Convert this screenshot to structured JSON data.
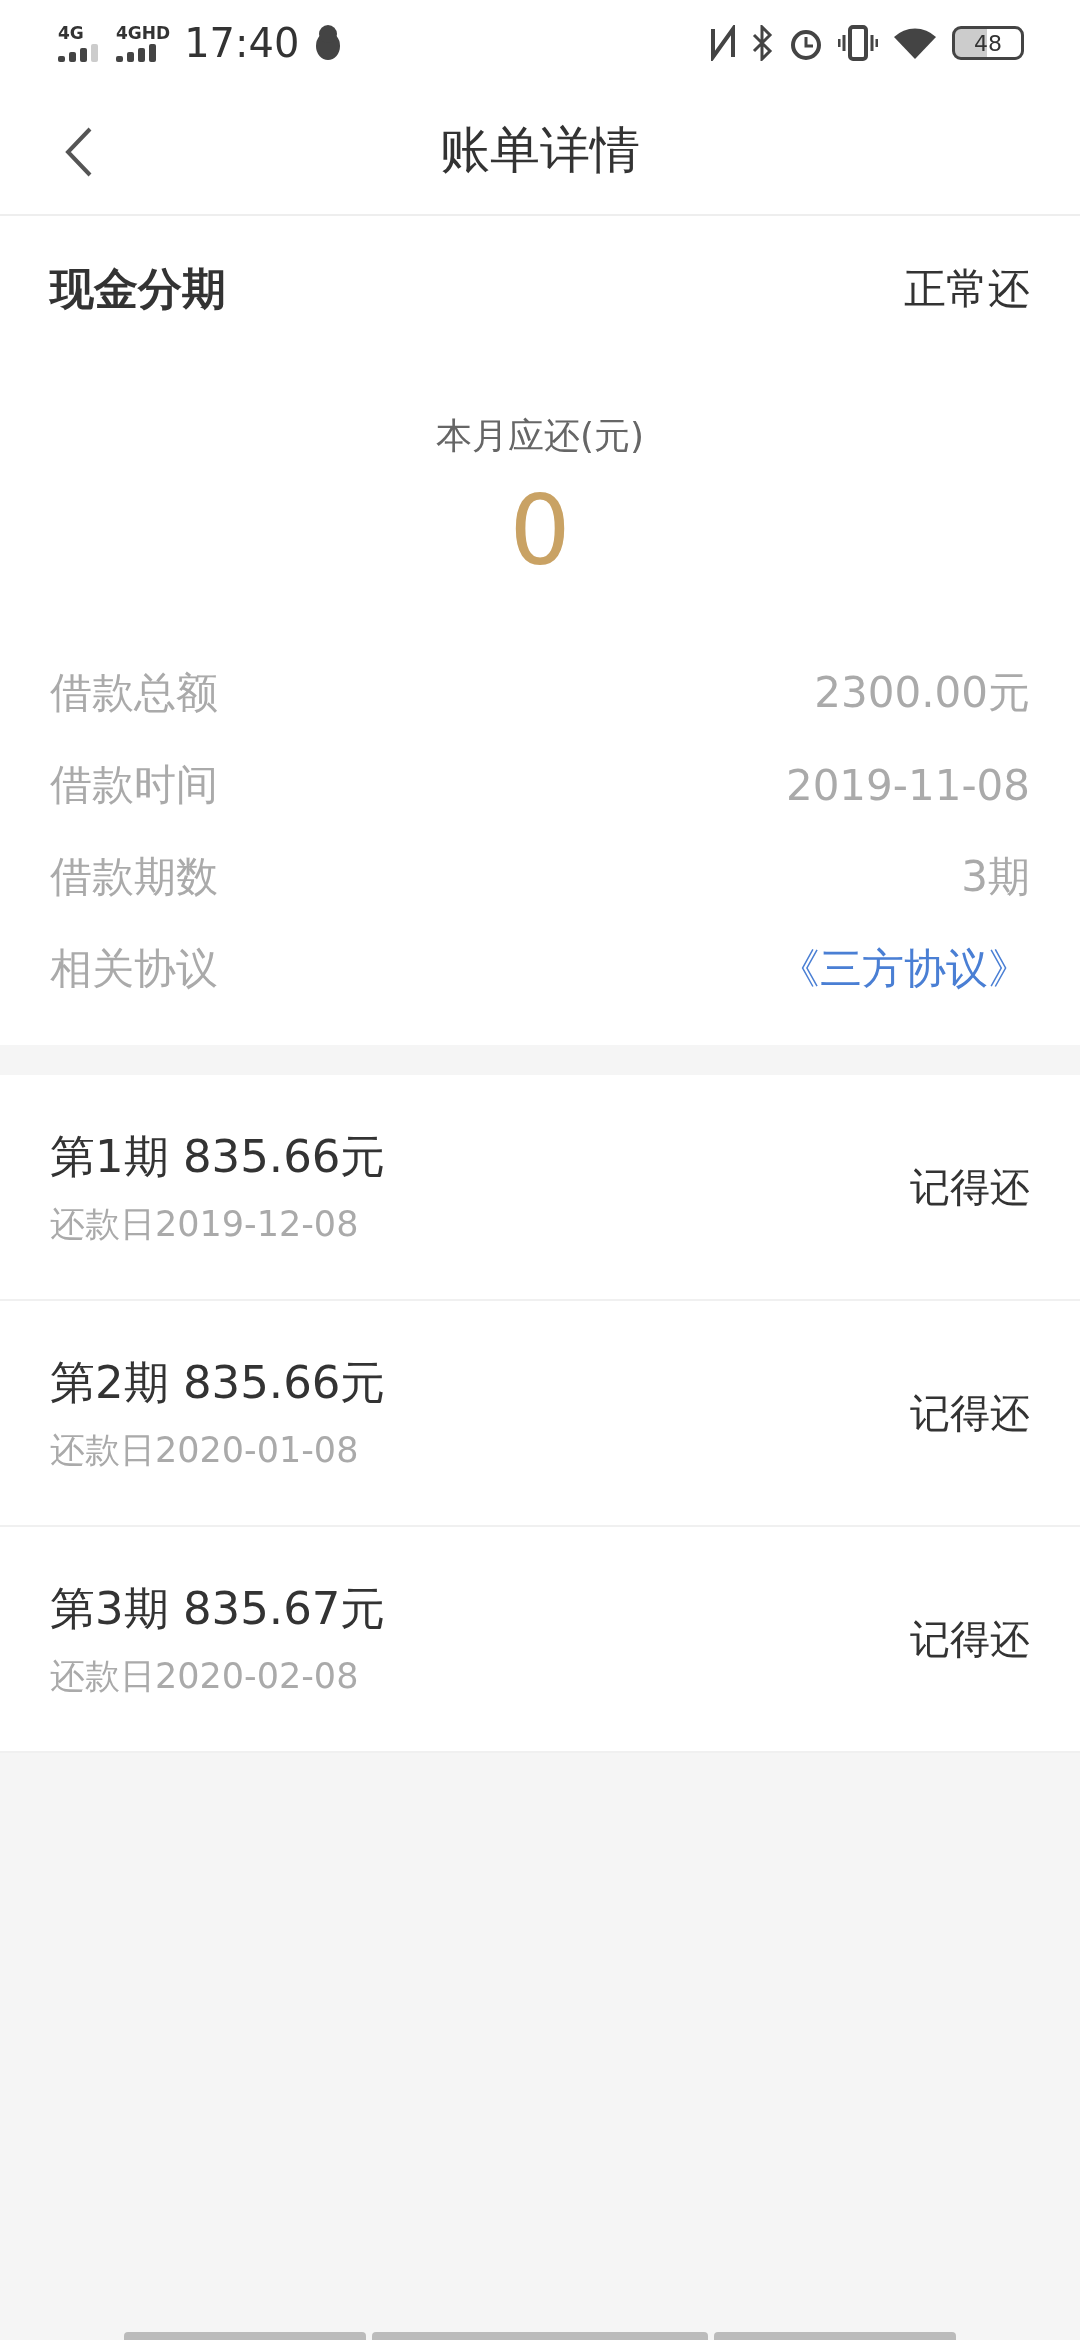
{
  "status_bar": {
    "network_1": "4G",
    "network_2": "4GHD",
    "time": "17:40",
    "battery": "48"
  },
  "nav": {
    "title": "账单详情"
  },
  "summary": {
    "product": "现金分期",
    "status": "正常还",
    "due_label": "本月应还(元)",
    "due_amount": "0",
    "rows": [
      {
        "kind": "text",
        "label": "借款总额",
        "value": "2300.00元"
      },
      {
        "kind": "text",
        "label": "借款时间",
        "value": "2019-11-08"
      },
      {
        "kind": "text",
        "label": "借款期数",
        "value": "3期"
      },
      {
        "kind": "link",
        "label": "相关协议",
        "value": "《三方协议》"
      }
    ]
  },
  "installments": [
    {
      "title": "第1期 835.66元",
      "date": "还款日2019-12-08",
      "status": "记得还"
    },
    {
      "title": "第2期 835.66元",
      "date": "还款日2020-01-08",
      "status": "记得还"
    },
    {
      "title": "第3期 835.67元",
      "date": "还款日2020-02-08",
      "status": "记得还"
    }
  ]
}
